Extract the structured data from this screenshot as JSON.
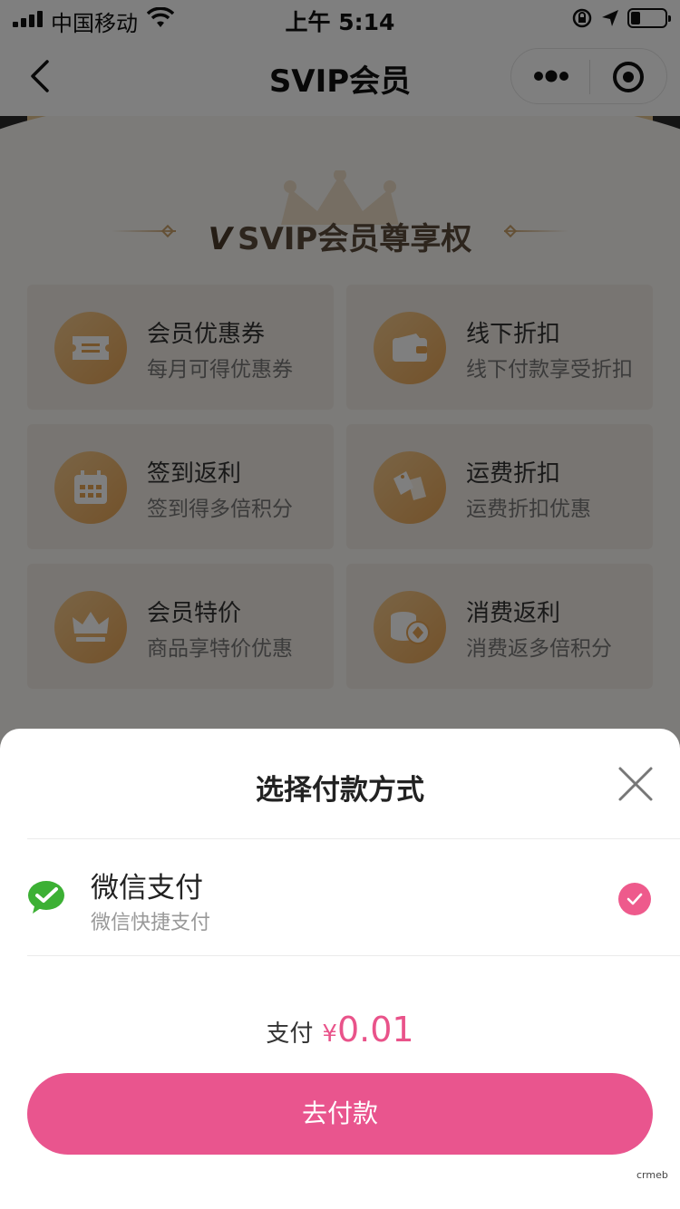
{
  "status_bar": {
    "carrier": "中国移动",
    "time": "上午 5:14"
  },
  "nav": {
    "title": "SVIP会员"
  },
  "section": {
    "title": "SVIP会员尊享权"
  },
  "benefits": [
    {
      "title": "会员优惠券",
      "desc": "每月可得优惠券",
      "icon": "coupon-icon"
    },
    {
      "title": "线下折扣",
      "desc": "线下付款享受折扣",
      "icon": "wallet-icon"
    },
    {
      "title": "签到返利",
      "desc": "签到得多倍积分",
      "icon": "calendar-icon"
    },
    {
      "title": "运费折扣",
      "desc": "运费折扣优惠",
      "icon": "tag-icon"
    },
    {
      "title": "会员特价",
      "desc": "商品享特价优惠",
      "icon": "crown-icon"
    },
    {
      "title": "消费返利",
      "desc": "消费返多倍积分",
      "icon": "coins-icon"
    }
  ],
  "payment_sheet": {
    "title": "选择付款方式",
    "method": {
      "name": "微信支付",
      "desc": "微信快捷支付",
      "selected": true
    },
    "pay_label": "支付",
    "currency": "¥",
    "amount": "0.01",
    "button_label": "去付款",
    "watermark": "crmeb"
  },
  "colors": {
    "accent": "#e9558e",
    "gold": "#e7a455",
    "wechat": "#3cb034"
  }
}
